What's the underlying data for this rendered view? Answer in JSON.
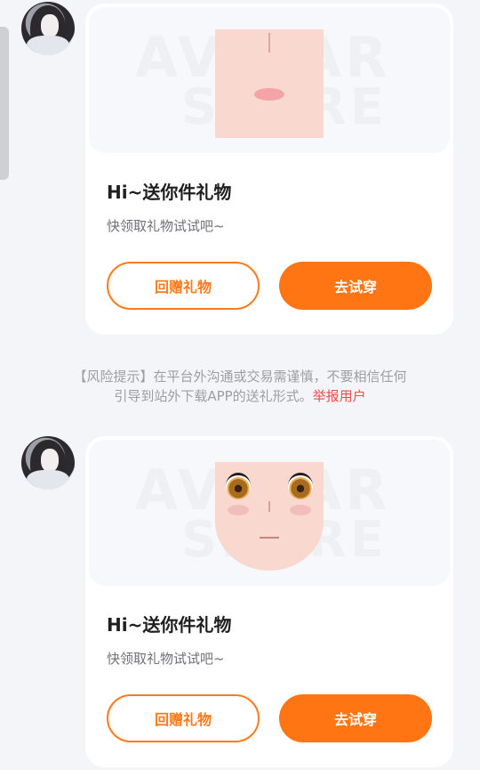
{
  "messages": [
    {
      "watermark": [
        "AVATAR",
        "SHARE"
      ],
      "title": "Hi~送你件礼物",
      "subtitle": "快领取礼物试试吧~",
      "buttons": {
        "regift": "回赠礼物",
        "try_on": "去试穿"
      },
      "preview": "mouth-nose-skin"
    },
    {
      "watermark": [
        "AVATAR",
        "SHARE"
      ],
      "title": "Hi~送你件礼物",
      "subtitle": "快领取礼物试试吧~",
      "buttons": {
        "regift": "回赠礼物",
        "try_on": "去试穿"
      },
      "preview": "anime-face"
    }
  ],
  "risk_notice": {
    "line1": "【风险提示】在平台外沟通或交易需谨慎，不要相信任何",
    "line2": "引导到站外下载APP的送礼形式。",
    "report_link": "举报用户"
  },
  "colors": {
    "accent": "#ff7413",
    "report": "#f04a4a",
    "background": "#f4f5f8"
  }
}
